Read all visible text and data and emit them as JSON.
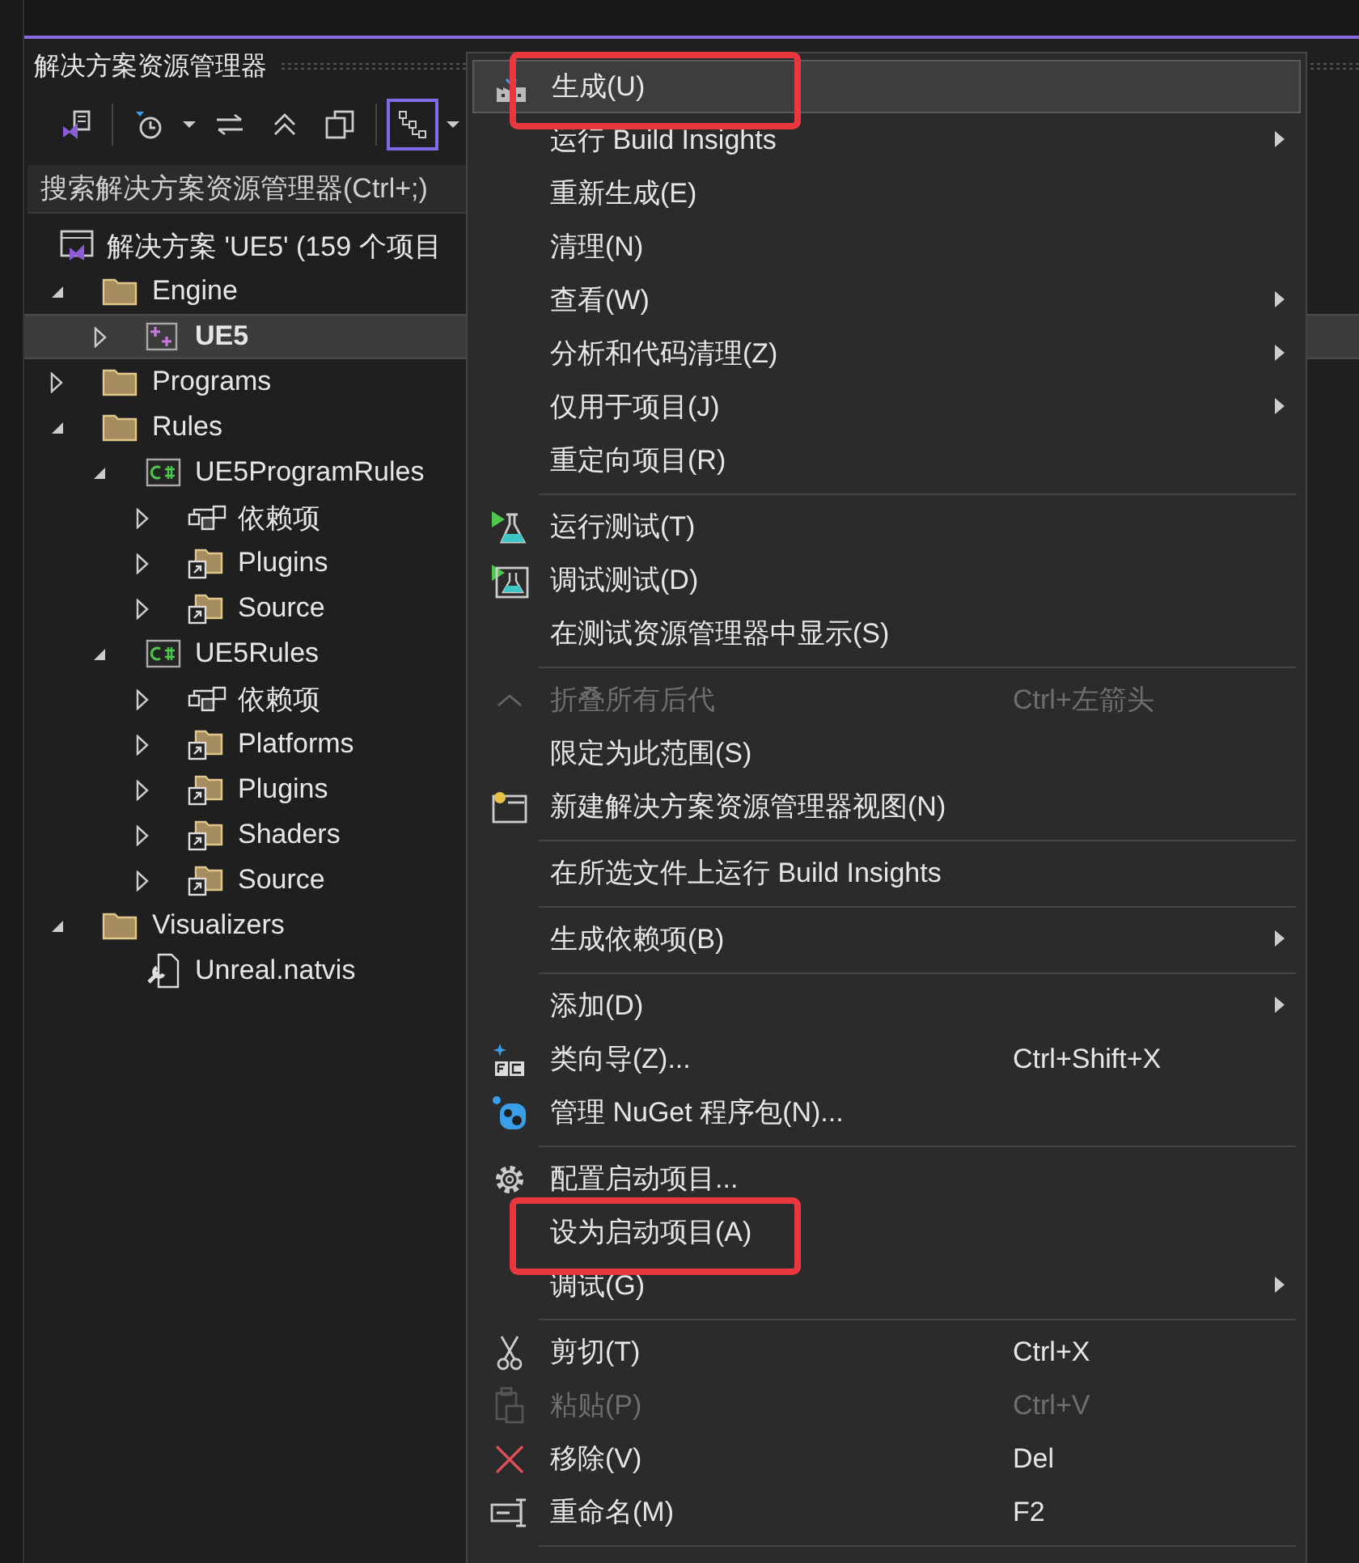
{
  "panel": {
    "title": "解决方案资源管理器"
  },
  "toolbar": [
    {
      "kind": "vs",
      "selected": false
    },
    {
      "kind": "history",
      "selected": false
    },
    {
      "kind": "dropdown",
      "selected": false
    },
    {
      "kind": "sync",
      "selected": false
    },
    {
      "kind": "collapse",
      "selected": false
    },
    {
      "kind": "copies",
      "selected": false
    },
    {
      "kind": "view",
      "selected": true
    },
    {
      "kind": "dropdown",
      "selected": false
    }
  ],
  "search": {
    "placeholder": "搜索解决方案资源管理器(Ctrl+;)"
  },
  "tree": [
    {
      "kind": "solution",
      "label": "解决方案 'UE5' (159 个项目",
      "selected": false,
      "children": [
        {
          "kind": "folder",
          "label": "Engine",
          "expanded": true,
          "selected": false,
          "children": [
            {
              "kind": "project",
              "label": "UE5",
              "expanded": false,
              "selected": true
            }
          ]
        },
        {
          "kind": "folder",
          "label": "Programs",
          "expanded": false,
          "selected": false
        },
        {
          "kind": "folder",
          "label": "Rules",
          "expanded": true,
          "selected": false,
          "children": [
            {
              "kind": "csproj",
              "label": "UE5ProgramRules",
              "expanded": true,
              "selected": false,
              "children": [
                {
                  "kind": "references",
                  "label": "依赖项",
                  "expanded": false,
                  "selected": false
                },
                {
                  "kind": "linked-folder",
                  "label": "Plugins",
                  "expanded": false,
                  "selected": false
                },
                {
                  "kind": "linked-folder",
                  "label": "Source",
                  "expanded": false,
                  "selected": false
                }
              ]
            },
            {
              "kind": "csproj",
              "label": "UE5Rules",
              "expanded": true,
              "selected": false,
              "children": [
                {
                  "kind": "references",
                  "label": "依赖项",
                  "expanded": false,
                  "selected": false
                },
                {
                  "kind": "linked-folder",
                  "label": "Platforms",
                  "expanded": false,
                  "selected": false
                },
                {
                  "kind": "linked-folder",
                  "label": "Plugins",
                  "expanded": false,
                  "selected": false
                },
                {
                  "kind": "linked-folder",
                  "label": "Shaders",
                  "expanded": false,
                  "selected": false
                },
                {
                  "kind": "linked-folder",
                  "label": "Source",
                  "expanded": false,
                  "selected": false
                }
              ]
            }
          ]
        },
        {
          "kind": "folder",
          "label": "Visualizers",
          "expanded": true,
          "selected": false,
          "children": [
            {
              "kind": "file",
              "label": "Unreal.natvis",
              "selected": false
            }
          ]
        }
      ]
    }
  ],
  "context_menu": [
    {
      "kind": "item",
      "label": "生成(U)",
      "highlighted": true,
      "annotated": true
    },
    {
      "kind": "item",
      "label": "运行 Build Insights",
      "submenu": true
    },
    {
      "kind": "item",
      "label": "重新生成(E)"
    },
    {
      "kind": "item",
      "label": "清理(N)"
    },
    {
      "kind": "item",
      "label": "查看(W)",
      "submenu": true
    },
    {
      "kind": "item",
      "label": "分析和代码清理(Z)",
      "submenu": true
    },
    {
      "kind": "item",
      "label": "仅用于项目(J)",
      "submenu": true
    },
    {
      "kind": "item",
      "label": "重定向项目(R)"
    },
    {
      "kind": "separator"
    },
    {
      "kind": "item",
      "label": "运行测试(T)"
    },
    {
      "kind": "item",
      "label": "调试测试(D)"
    },
    {
      "kind": "item",
      "label": "在测试资源管理器中显示(S)"
    },
    {
      "kind": "separator"
    },
    {
      "kind": "item",
      "label": "折叠所有后代",
      "shortcut": "Ctrl+左箭头",
      "disabled": true
    },
    {
      "kind": "item",
      "label": "限定为此范围(S)"
    },
    {
      "kind": "item",
      "label": "新建解决方案资源管理器视图(N)"
    },
    {
      "kind": "separator"
    },
    {
      "kind": "item",
      "label": "在所选文件上运行 Build Insights"
    },
    {
      "kind": "separator"
    },
    {
      "kind": "item",
      "label": "生成依赖项(B)",
      "submenu": true
    },
    {
      "kind": "separator"
    },
    {
      "kind": "item",
      "label": "添加(D)",
      "submenu": true
    },
    {
      "kind": "item",
      "label": "类向导(Z)...",
      "shortcut": "Ctrl+Shift+X"
    },
    {
      "kind": "item",
      "label": "管理 NuGet 程序包(N)..."
    },
    {
      "kind": "separator"
    },
    {
      "kind": "item",
      "label": "配置启动项目..."
    },
    {
      "kind": "item",
      "label": "设为启动项目(A)",
      "annotated": true
    },
    {
      "kind": "item",
      "label": "调试(G)",
      "submenu": true
    },
    {
      "kind": "separator"
    },
    {
      "kind": "item",
      "label": "剪切(T)",
      "shortcut": "Ctrl+X"
    },
    {
      "kind": "item",
      "label": "粘贴(P)",
      "shortcut": "Ctrl+V",
      "disabled": true
    },
    {
      "kind": "item",
      "label": "移除(V)",
      "shortcut": "Del"
    },
    {
      "kind": "item",
      "label": "重命名(M)",
      "shortcut": "F2"
    },
    {
      "kind": "separator"
    }
  ]
}
